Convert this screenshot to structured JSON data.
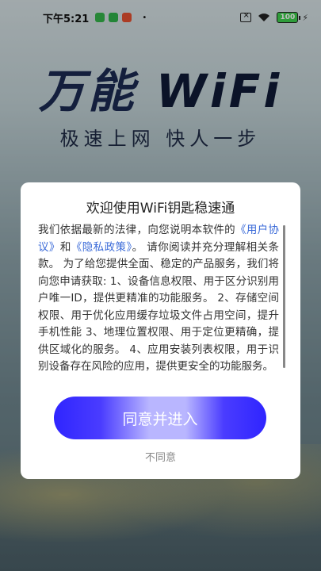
{
  "status_bar": {
    "time": "下午5:21",
    "battery": "100",
    "dot": "•"
  },
  "brand": {
    "title_cn": "万能",
    "title_en": "WiFi",
    "slogan": "极速上网 快人一步"
  },
  "dialog": {
    "title": "欢迎使用WiFi钥匙稳速通",
    "policy": {
      "intro": "我们依据最新的法律，向您说明本软件的",
      "user_agreement_link": "《用户协议》",
      "and": "和",
      "privacy_link": "《隐私政策》",
      "body": "。 请你阅读并充分理解相关条款。 为了给您提供全面、稳定的产品服务，我们将向您申请获取: 1、设备信息权限、用于区分识别用户唯一ID，提供更精准的功能服务。 2、存储空间权限、用于优化应用缓存垃圾文件占用空间，提升手机性能 3、地理位置权限、用于定位更精确，提供区域化的服务。 4、应用安装列表权限，用于识别设备存在风险的应用，提供更安全的功能服务。"
    },
    "agree_label": "同意并进入",
    "disagree_label": "不同意"
  },
  "colors": {
    "button_blue": "#2f25ff",
    "link_blue": "#3a6ad8"
  }
}
